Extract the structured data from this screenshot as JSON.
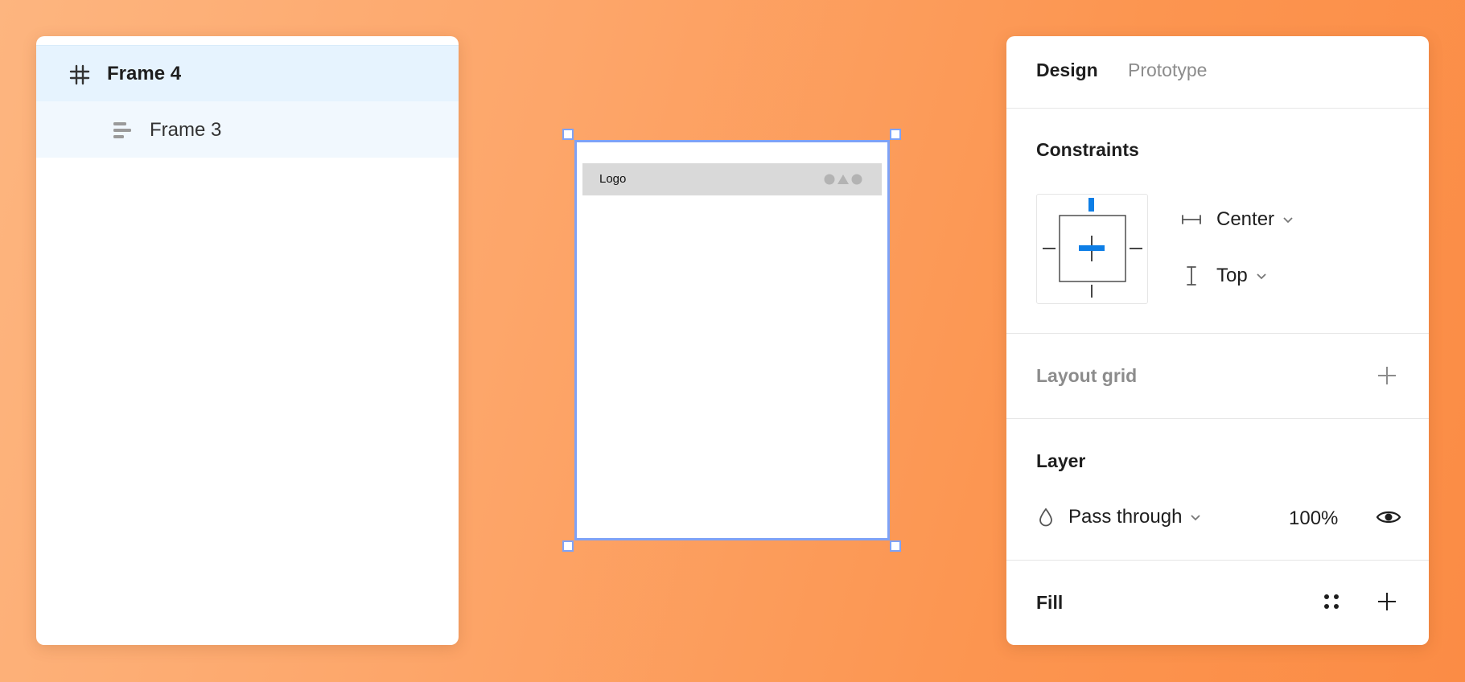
{
  "layers": {
    "items": [
      {
        "label": "Frame 4",
        "icon": "frame-hash-icon",
        "selected": true
      },
      {
        "label": "Frame 3",
        "icon": "auto-layout-icon",
        "selected": false
      }
    ]
  },
  "canvas": {
    "navbar": {
      "logo_text": "Logo"
    }
  },
  "design_panel": {
    "tabs": [
      {
        "label": "Design",
        "active": true
      },
      {
        "label": "Prototype",
        "active": false
      }
    ],
    "constraints": {
      "title": "Constraints",
      "horizontal": "Center",
      "vertical": "Top"
    },
    "layout_grid": {
      "title": "Layout grid"
    },
    "layer": {
      "title": "Layer",
      "blend_mode": "Pass through",
      "opacity": "100%"
    },
    "fill": {
      "title": "Fill"
    }
  },
  "colors": {
    "accent": "#0d7ee6",
    "selection": "#7ea2f6",
    "layer_selected_bg": "#e6f3fe",
    "background_start": "#fdb57f",
    "background_end": "#fb8c45"
  }
}
